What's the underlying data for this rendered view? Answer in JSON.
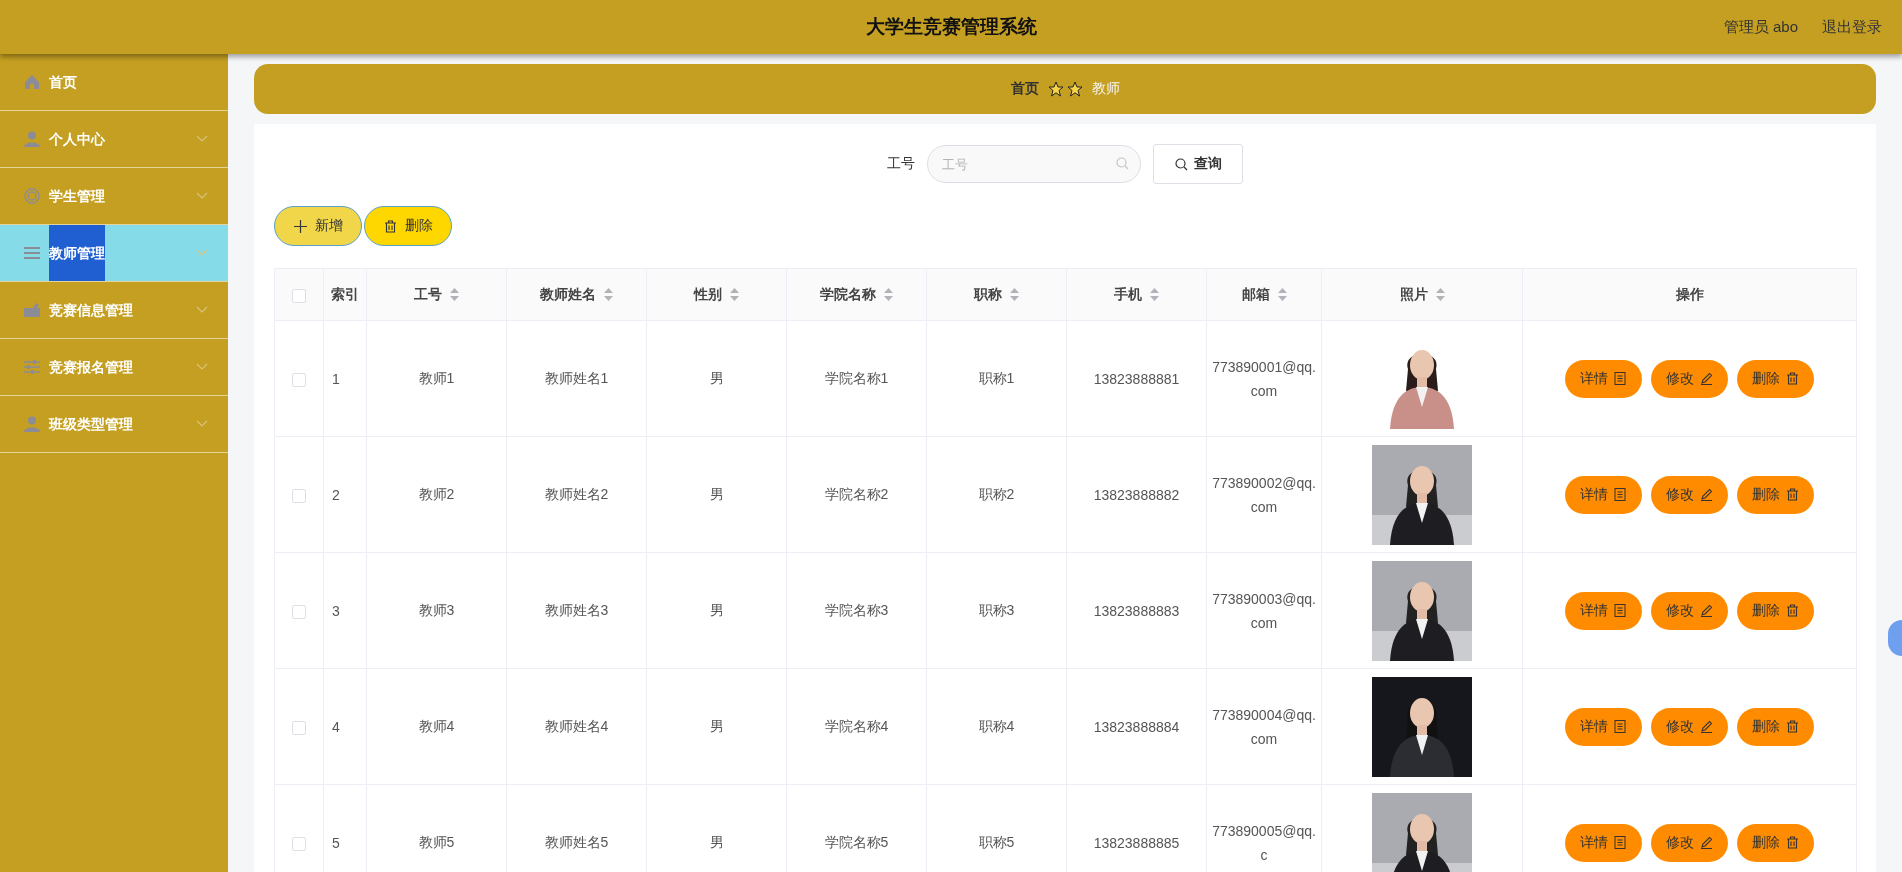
{
  "header": {
    "title": "大学生竞赛管理系统",
    "user": "管理员 abo",
    "logout": "退出登录"
  },
  "sidebar": {
    "items": [
      {
        "label": "首页",
        "kind": "link",
        "selected": false
      },
      {
        "label": "个人中心",
        "kind": "submenu",
        "selected": false
      },
      {
        "label": "学生管理",
        "kind": "submenu",
        "selected": false
      },
      {
        "label": "教师管理",
        "kind": "submenu",
        "selected": true
      },
      {
        "label": "竞赛信息管理",
        "kind": "submenu",
        "selected": false
      },
      {
        "label": "竞赛报名管理",
        "kind": "submenu",
        "selected": false
      },
      {
        "label": "班级类型管理",
        "kind": "submenu",
        "selected": false
      }
    ]
  },
  "breadcrumb": [
    {
      "label": "首页",
      "current": false
    },
    {
      "label": "教师",
      "current": true
    }
  ],
  "search": {
    "label": "工号",
    "placeholder": "工号",
    "button": "查询"
  },
  "toolbar": [
    {
      "label": "新增",
      "kind": "add"
    },
    {
      "label": "删除",
      "kind": "delete"
    }
  ],
  "table": {
    "select_all": {
      "checked": false
    },
    "columns": [
      {
        "label": "索引",
        "sortable": false
      },
      {
        "label": "工号",
        "sortable": true
      },
      {
        "label": "教师姓名",
        "sortable": true
      },
      {
        "label": "性别",
        "sortable": true
      },
      {
        "label": "学院名称",
        "sortable": true
      },
      {
        "label": "职称",
        "sortable": true
      },
      {
        "label": "手机",
        "sortable": true
      },
      {
        "label": "邮箱",
        "sortable": true
      },
      {
        "label": "照片",
        "sortable": true
      },
      {
        "label": "操作",
        "sortable": false
      }
    ],
    "rows": [
      {
        "checked": false,
        "cells": [
          "1",
          "教师1",
          "教师姓名1",
          "男",
          "学院名称1",
          "职称1",
          "13823888881",
          "773890001@qq.com"
        ],
        "actions": [
          "详情",
          "修改",
          "删除"
        ]
      },
      {
        "checked": false,
        "cells": [
          "2",
          "教师2",
          "教师姓名2",
          "男",
          "学院名称2",
          "职称2",
          "13823888882",
          "773890002@qq.com"
        ],
        "actions": [
          "详情",
          "修改",
          "删除"
        ]
      },
      {
        "checked": false,
        "cells": [
          "3",
          "教师3",
          "教师姓名3",
          "男",
          "学院名称3",
          "职称3",
          "13823888883",
          "773890003@qq.com"
        ],
        "actions": [
          "详情",
          "修改",
          "删除"
        ]
      },
      {
        "checked": false,
        "cells": [
          "4",
          "教师4",
          "教师姓名4",
          "男",
          "学院名称4",
          "职称4",
          "13823888884",
          "773890004@qq.com"
        ],
        "actions": [
          "详情",
          "修改",
          "删除"
        ]
      },
      {
        "checked": false,
        "cells": [
          "5",
          "教师5",
          "教师姓名5",
          "男",
          "学院名称5",
          "职称5",
          "13823888885",
          "773890005@qq.c"
        ],
        "actions": [
          "详情",
          "修改",
          "删除"
        ]
      }
    ]
  }
}
